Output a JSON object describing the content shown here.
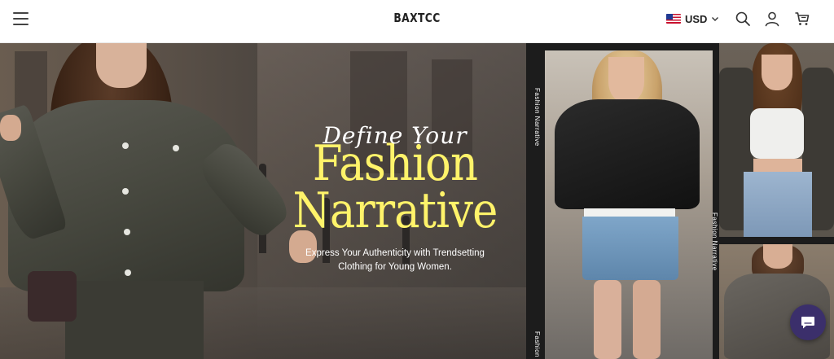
{
  "header": {
    "menu_icon": "hamburger-menu-icon",
    "logo": "BAXTCC",
    "currency": {
      "code": "USD",
      "flag": "us-flag-icon"
    },
    "icons": [
      "search-icon",
      "account-icon",
      "cart-icon"
    ]
  },
  "hero": {
    "script_title": "Define Your",
    "headline_line1": "Fashion",
    "headline_line2": "Narrative",
    "subtitle_line1": "Express Your Authenticity with Trendsetting",
    "subtitle_line2": "Clothing for Young Women.",
    "vertical_label_1": "Fashion Narrative",
    "vertical_label_2": "Fashion Narrative",
    "vertical_label_3": "Fashion N",
    "colors": {
      "headline": "#fff36a",
      "subtitle": "#ffffff"
    }
  },
  "chat": {
    "icon": "chat-bubble-icon"
  }
}
